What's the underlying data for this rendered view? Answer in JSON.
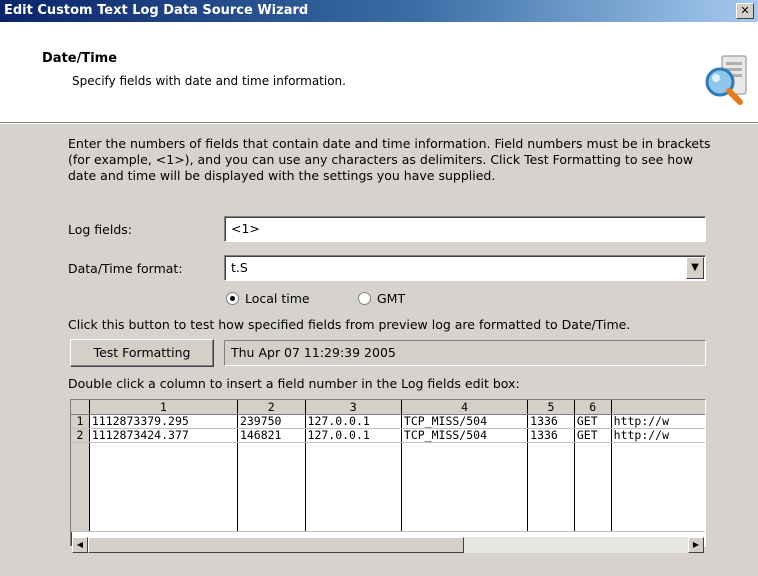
{
  "window": {
    "title": "Edit Custom Text Log Data Source Wizard",
    "close_label": "✕"
  },
  "header": {
    "title": "Date/Time",
    "subtitle": "Specify fields with date and time information.",
    "icon": "search-computer-icon"
  },
  "instructions": "Enter the numbers of fields that contain date and time information. Field numbers must be in brackets (for example, <1>), and you can use any characters as delimiters. Click Test Formatting to see how date and time will be displayed with the settings you have supplied.",
  "log_fields": {
    "label": "Log fields:",
    "value": "<1>"
  },
  "datetime_format": {
    "label": "Data/Time format:",
    "value": "t.S"
  },
  "timezone": {
    "options": [
      "Local time",
      "GMT"
    ],
    "selected": "Local time"
  },
  "test_hint": "Click this button to test how specified fields from preview log are formatted to Date/Time.",
  "test_button": {
    "label": "Test Formatting"
  },
  "test_result": "Thu Apr 07 11:29:39 2005",
  "grid_hint": "Double click a column to insert a field number in the Log fields edit box:",
  "grid": {
    "headers": [
      "1",
      "2",
      "3",
      "4",
      "5",
      "6",
      ""
    ],
    "rows": [
      {
        "num": "1",
        "cells": [
          "1112873379.295",
          "239750",
          "127.0.0.1",
          "TCP_MISS/504",
          "1336",
          "GET",
          "http://w"
        ]
      },
      {
        "num": "2",
        "cells": [
          "1112873424.377",
          "146821",
          "127.0.0.1",
          "TCP_MISS/504",
          "1336",
          "GET",
          "http://w"
        ]
      }
    ]
  }
}
